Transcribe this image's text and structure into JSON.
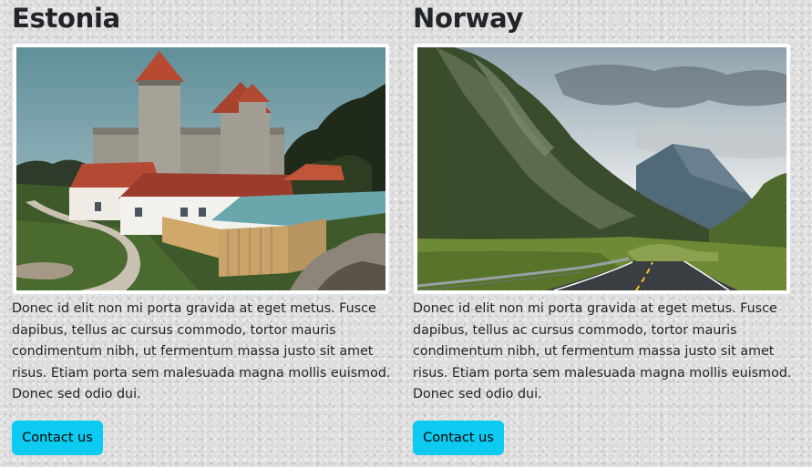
{
  "cards": [
    {
      "title": "Estonia",
      "image_subject": "castle",
      "text": "Donec id elit non mi porta gravida at eget metus. Fusce dapibus, tellus ac cursus commodo, tortor mauris condimentum nibh, ut fermentum massa justo sit amet risus. Etiam porta sem malesuada magna mollis euismod. Donec sed odio dui.",
      "button_label": "Contact us"
    },
    {
      "title": "Norway",
      "image_subject": "mountain-road",
      "text": "Donec id elit non mi porta gravida at eget metus. Fusce dapibus, tellus ac cursus commodo, tortor mauris condimentum nibh, ut fermentum massa justo sit amet risus. Etiam porta sem malesuada magna mollis euismod. Donec sed odio dui.",
      "button_label": "Contact us"
    }
  ],
  "colors": {
    "button": "#0dcaf0",
    "text": "#212529"
  }
}
